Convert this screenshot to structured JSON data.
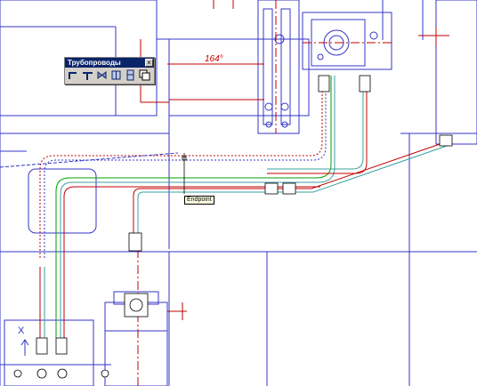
{
  "toolbar": {
    "title": "Трубопроводы",
    "close_label": "×",
    "buttons": [
      {
        "icon": "pipe-elbow-icon"
      },
      {
        "icon": "pipe-tee-icon"
      },
      {
        "icon": "pipe-valve-icon"
      },
      {
        "icon": "pipe-flange-icon"
      },
      {
        "icon": "pipe-fitting-icon"
      },
      {
        "icon": "pipe-copy-icon"
      }
    ]
  },
  "drawing": {
    "dimension_text": "164°",
    "axis_label": "X"
  },
  "tooltip": {
    "text": "Endpoint"
  },
  "colors": {
    "outline": "#3434c8",
    "pipe_red": "#c00000",
    "pipe_green": "#00a000",
    "pipe_cyan": "#3aa0a0",
    "titlebar": "#0a246a"
  }
}
